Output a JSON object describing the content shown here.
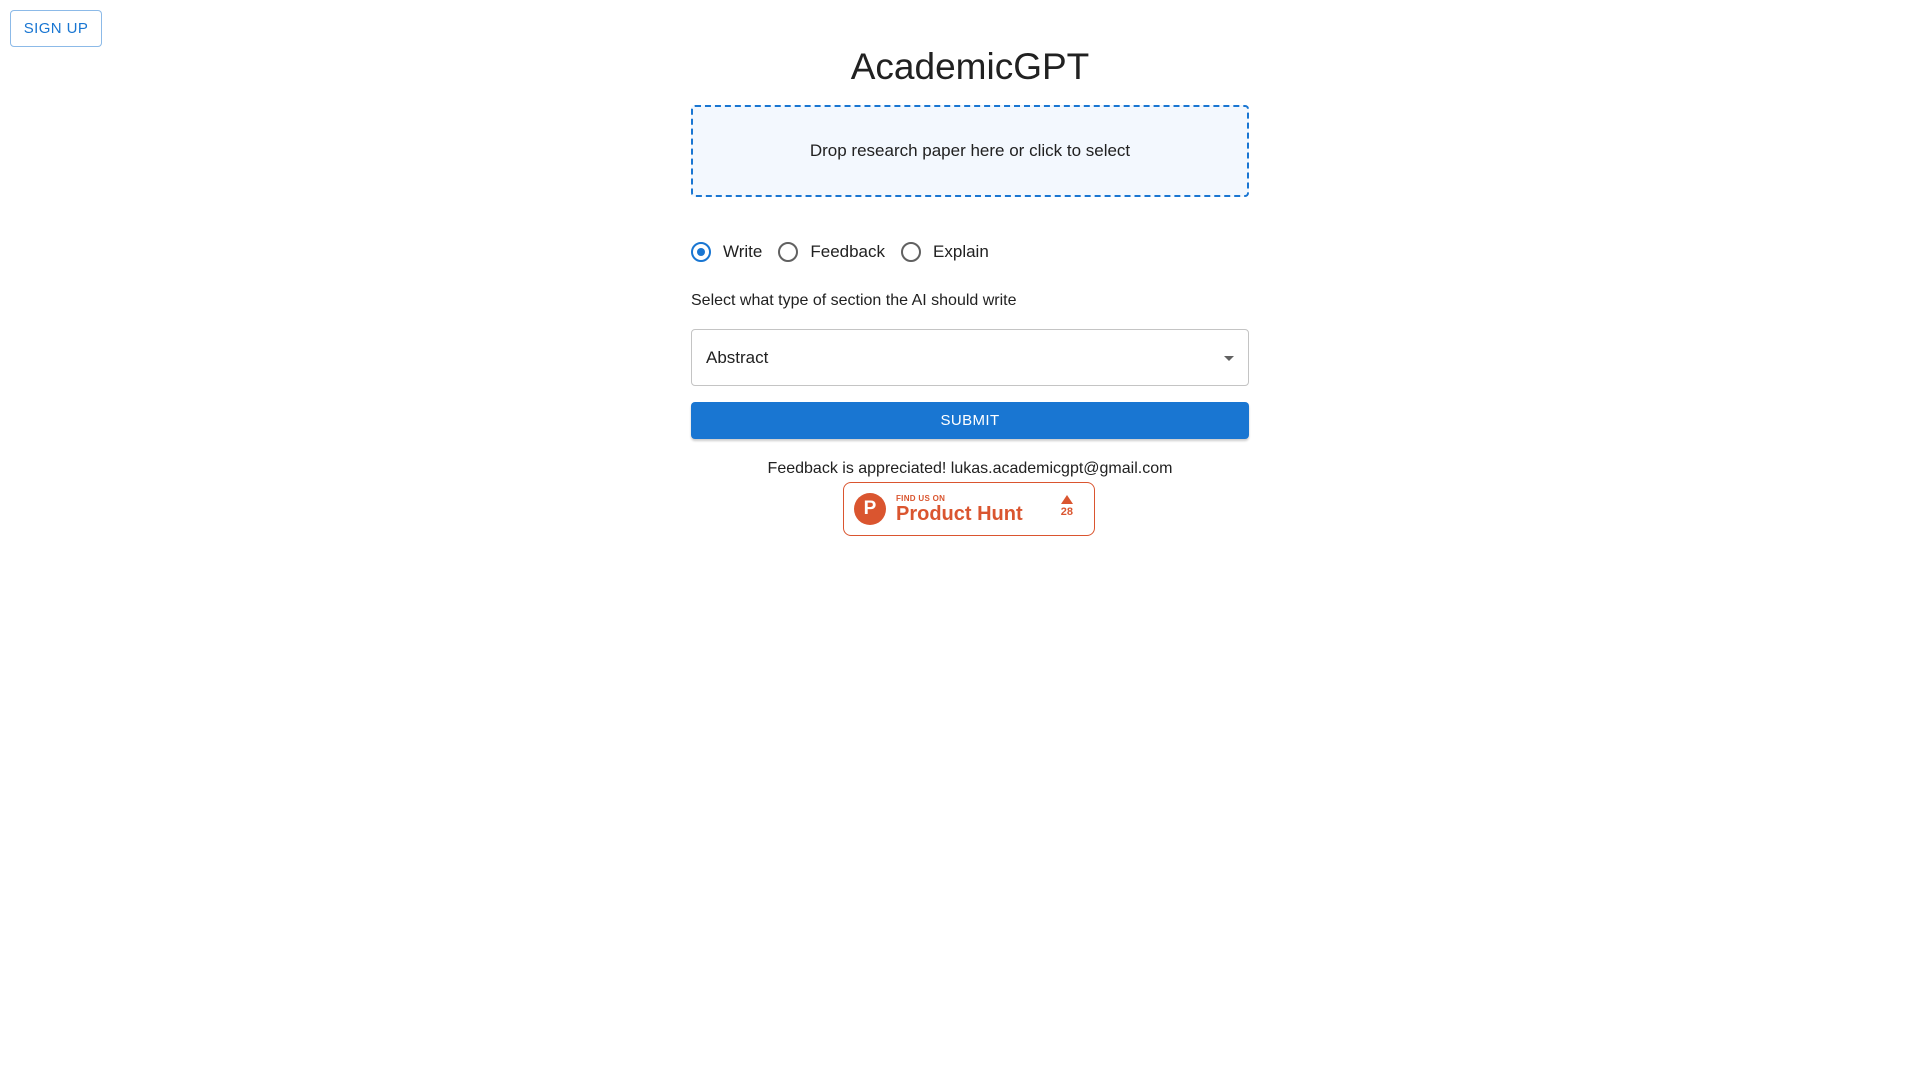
{
  "header": {
    "signup_label": "SIGN UP"
  },
  "main": {
    "title": "AcademicGPT",
    "dropzone_text": "Drop research paper here or click to select",
    "modes": [
      {
        "label": "Write",
        "selected": true
      },
      {
        "label": "Feedback",
        "selected": false
      },
      {
        "label": "Explain",
        "selected": false
      }
    ],
    "section_prompt": "Select what type of section the AI should write",
    "section_select": {
      "value": "Abstract"
    },
    "submit_label": "SUBMIT",
    "feedback_note": "Feedback is appreciated! lukas.academicgpt@gmail.com"
  },
  "product_hunt": {
    "logo_letter": "P",
    "small_text": "FIND US ON",
    "big_text": "Product Hunt",
    "votes": "28"
  },
  "colors": {
    "primary": "#1976d2",
    "product_hunt": "#da552f",
    "dropzone_bg": "#f3f8fe"
  }
}
